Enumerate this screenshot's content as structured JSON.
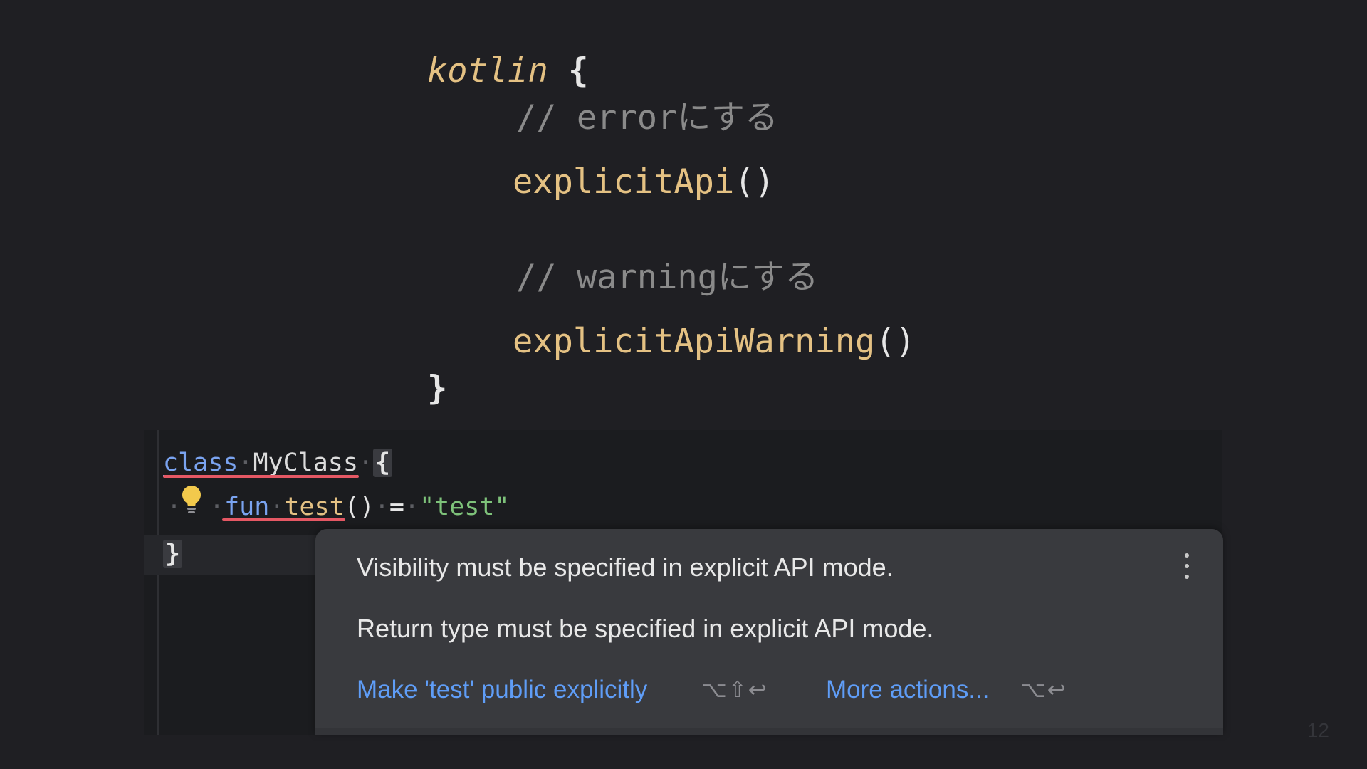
{
  "slide_code": {
    "kotlin_keyword": "kotlin",
    "open_brace": "{",
    "comment_error": "// errorにする",
    "call_error_fn": "explicitApi",
    "call_error_parens": "()",
    "comment_warning": "// warningにする",
    "call_warning_fn": "explicitApiWarning",
    "call_warning_parens": "()",
    "close_brace": "}"
  },
  "editor": {
    "line1": {
      "keyword": "class",
      "dot1": "·",
      "class_name": "MyClass",
      "dot2": "·",
      "brace": "{"
    },
    "line2": {
      "lead_dots": "·",
      "dot_after_bulb": "·",
      "keyword": "fun",
      "dot1": "·",
      "fn_name": "test",
      "parens": "()",
      "dot2": "·",
      "equals": "=",
      "dot3": "·",
      "string": "\"test\""
    },
    "line3": {
      "brace": "}"
    },
    "bulb_icon": "lightbulb-icon",
    "colors": {
      "keyword": "#7aa3f0",
      "function": "#e4c183",
      "string": "#7ec27a",
      "error_underline": "#e55864",
      "bulb": "#f2c94c"
    }
  },
  "popup": {
    "message_1": "Visibility must be specified in explicit API mode.",
    "message_2": "Return type must be specified in explicit API mode.",
    "menu_icon": "more-vertical-icon",
    "action_primary": "Make 'test' public explicitly",
    "action_primary_shortcut": "⌥⇧↩",
    "action_more": "More actions...",
    "action_more_shortcut": "⌥↩",
    "link_color": "#5f9df7"
  },
  "page_number": "12"
}
